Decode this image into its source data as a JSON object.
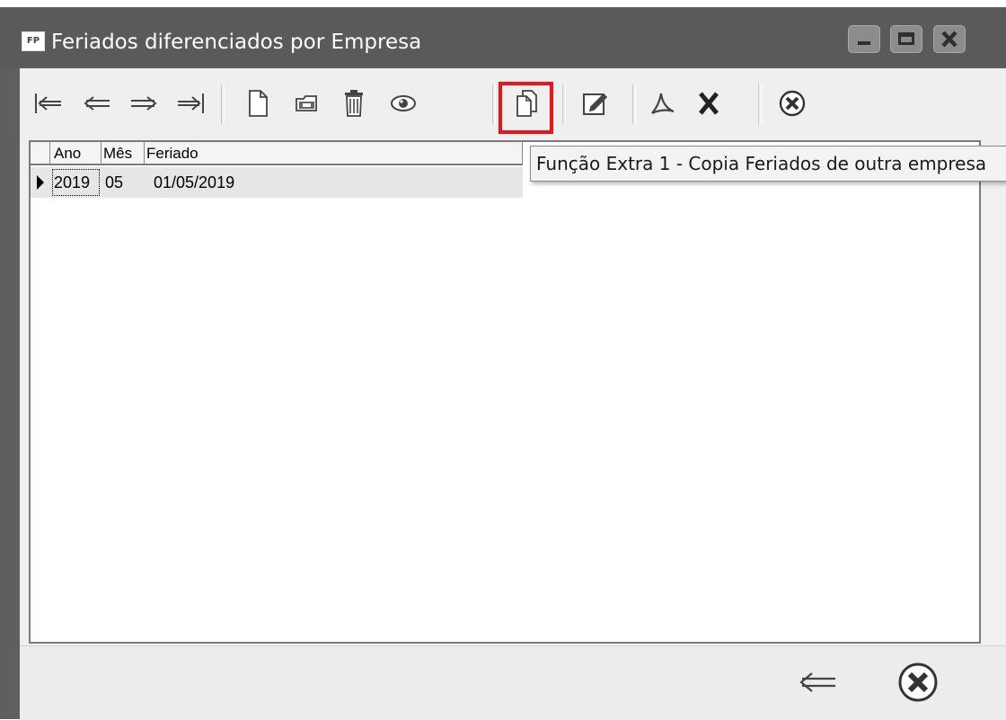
{
  "window": {
    "title": "Feriados diferenciados por Empresa",
    "app_icon_text": "FP"
  },
  "toolbar": {
    "buttons": [
      {
        "icon": "first-record-icon"
      },
      {
        "icon": "previous-record-icon"
      },
      {
        "icon": "next-record-icon"
      },
      {
        "icon": "last-record-icon"
      },
      {
        "icon": "new-document-icon"
      },
      {
        "icon": "open-folder-icon"
      },
      {
        "icon": "trash-icon"
      },
      {
        "icon": "view-eye-icon"
      },
      {
        "icon": "copy-icon",
        "highlighted": true
      },
      {
        "icon": "edit-icon"
      },
      {
        "icon": "pdf-icon"
      },
      {
        "icon": "excel-x-icon"
      },
      {
        "icon": "close-circle-icon"
      }
    ]
  },
  "tooltip": {
    "text": "Função Extra 1 - Copia Feriados de outra empresa"
  },
  "grid": {
    "columns": [
      "Ano",
      "Mês",
      "Feriado"
    ],
    "rows": [
      {
        "ano": "2019",
        "mes": "05",
        "feriado": "01/05/2019"
      }
    ]
  },
  "bottom": {
    "buttons": [
      {
        "icon": "back-arrow-icon"
      },
      {
        "icon": "close-circle-icon"
      }
    ]
  },
  "colors": {
    "titlebar": "#5a5a5a",
    "highlight": "#e8141b"
  }
}
